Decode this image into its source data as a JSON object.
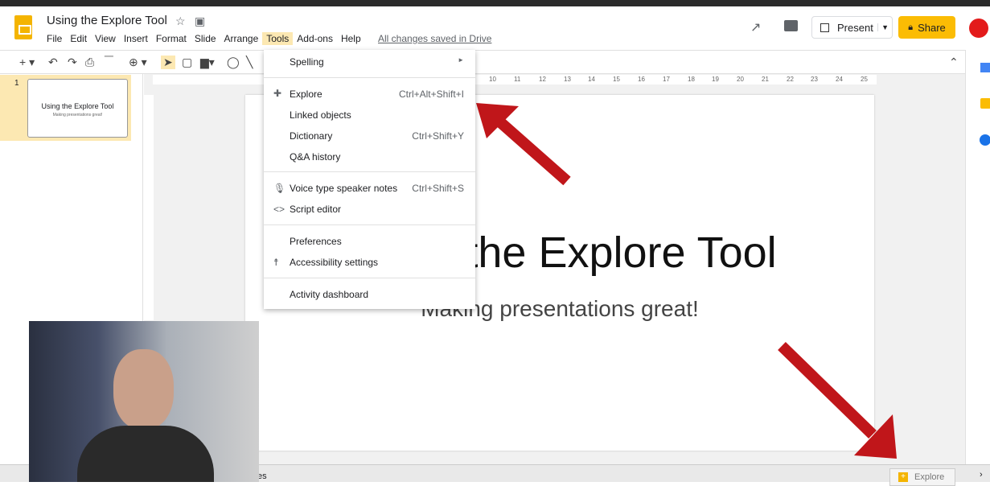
{
  "doc": {
    "title": "Using the Explore Tool",
    "saved": "All changes saved in Drive"
  },
  "menubar": [
    "File",
    "Edit",
    "View",
    "Insert",
    "Format",
    "Slide",
    "Arrange",
    "Tools",
    "Add-ons",
    "Help"
  ],
  "header": {
    "present": "Present",
    "share": "Share"
  },
  "filmstrip": {
    "slide_number": "1",
    "thumb_title": "Using the Explore Tool",
    "thumb_sub": "Making presentations great!"
  },
  "ruler": [
    "10",
    "11",
    "12",
    "13",
    "14",
    "15",
    "16",
    "17",
    "18",
    "19",
    "20",
    "21",
    "22",
    "23",
    "24",
    "25"
  ],
  "slide": {
    "title": "Using the Explore Tool",
    "title_visible": "he Explore Tool",
    "subtitle": "Making presentations great!"
  },
  "tools_menu": [
    {
      "label": "Spelling",
      "shortcut": "►"
    },
    {
      "label": "Explore",
      "shortcut": "Ctrl+Alt+Shift+I"
    },
    {
      "label": "Linked objects",
      "shortcut": ""
    },
    {
      "label": "Dictionary",
      "shortcut": "Ctrl+Shift+Y"
    },
    {
      "label": "Q&A history",
      "shortcut": ""
    },
    {
      "label": "Voice type speaker notes",
      "shortcut": "Ctrl+Shift+S"
    },
    {
      "label": "Script editor",
      "shortcut": ""
    },
    {
      "label": "Preferences",
      "shortcut": ""
    },
    {
      "label": "Accessibility settings",
      "shortcut": ""
    },
    {
      "label": "Activity dashboard",
      "shortcut": ""
    }
  ],
  "bottom": {
    "explore": "Explore",
    "notes_fragment": "es"
  },
  "colors": {
    "accent": "#fbbc04",
    "arrow": "#c0161a"
  }
}
